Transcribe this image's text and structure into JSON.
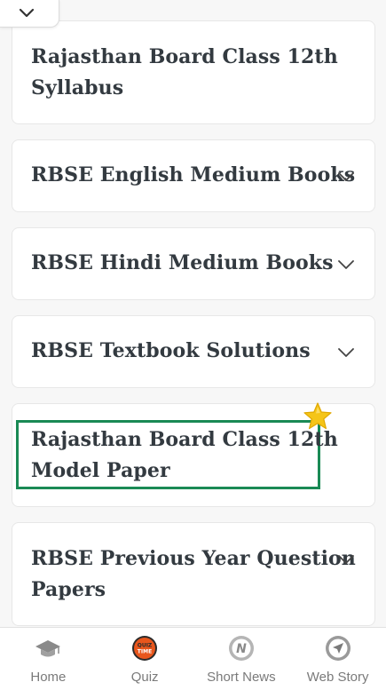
{
  "menu": {
    "cards": [
      {
        "title_line1": "Rajasthan Board Class 12th",
        "title_line2": "Syllabus"
      },
      {
        "title": "RBSE English Medium Books"
      },
      {
        "title": "RBSE Hindi Medium Books"
      },
      {
        "title": "RBSE Textbook Solutions"
      },
      {
        "title_line1": "Rajasthan Board Class 12th",
        "title_line2": "Model Paper"
      },
      {
        "title_line1": "RBSE Previous Year Question",
        "title_line2": "Papers"
      }
    ]
  },
  "bottom_nav": {
    "items": [
      {
        "label": "Home",
        "icon": "graduation-cap-icon"
      },
      {
        "label": "Quiz",
        "icon": "quiz-time-icon",
        "badge_text": "QUIZ TIME"
      },
      {
        "label": "Short News",
        "icon": "news-n-icon",
        "badge_text": "N"
      },
      {
        "label": "Web Story",
        "icon": "web-story-icon"
      }
    ]
  },
  "colors": {
    "highlight_border": "#1a8a55",
    "card_text": "#333a40",
    "nav_label": "#7a7a7a",
    "star": "#f5c518",
    "quiz_badge": "#e8561c"
  }
}
